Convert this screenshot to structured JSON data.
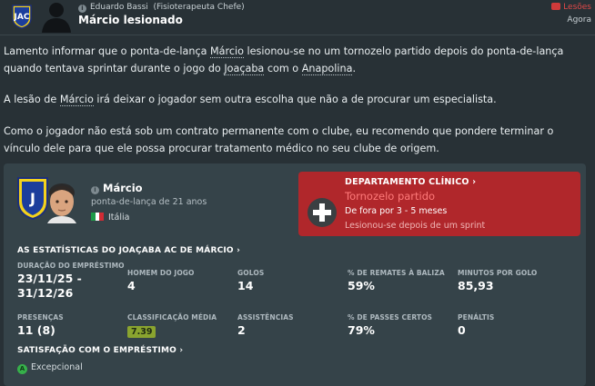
{
  "header": {
    "sender_name": "Eduardo Bassi",
    "sender_role": "(Fisioterapeuta Chefe)",
    "subject": "Márcio lesionado",
    "tag": "Lesões",
    "time": "Agora",
    "logo_letters": "JAC"
  },
  "body": {
    "p1": [
      {
        "t": "Lamento informar que o ponta-de-lança "
      },
      {
        "t": "Márcio",
        "u": true
      },
      {
        "t": " lesionou-se no um tornozelo partido depois do ponta-de-lança quando tentava sprintar durante o jogo do "
      },
      {
        "t": "Joaçaba",
        "u": true
      },
      {
        "t": " com o "
      },
      {
        "t": "Anapolina",
        "u": true
      },
      {
        "t": "."
      }
    ],
    "p2": [
      {
        "t": "A lesão de "
      },
      {
        "t": "Márcio",
        "u": true
      },
      {
        "t": " irá deixar o jogador sem outra escolha que não a de procurar um especialista."
      }
    ],
    "p3": [
      {
        "t": "Como o jogador não está sob um contrato permanente com o clube, eu recomendo que pondere terminar o vínculo dele para que ele possa procurar tratamento médico no seu clube de origem."
      }
    ]
  },
  "player": {
    "name": "Márcio",
    "position": "ponta-de-lança de 21 anos",
    "nationality": "Itália",
    "flag_colors": [
      "#1f9a48",
      "#ffffff",
      "#d12b34"
    ]
  },
  "medical": {
    "title": "DEPARTAMENTO CLÍNICO ›",
    "injury": "Tornozelo partido",
    "out": "De fora por 3 - 5 meses",
    "cause": "Lesionou-se depois de um sprint"
  },
  "stats_title": "AS ESTATÍSTICAS DO JOAÇABA AC DE MÁRCIO ›",
  "stats": {
    "loan_label": "DURAÇÃO DO EMPRÉSTIMO",
    "loan_value_1": "23/11/25 -",
    "loan_value_2": "31/12/26",
    "motm_label": "HOMEM DO JOGO",
    "motm_value": "4",
    "goals_label": "GOLOS",
    "goals_value": "14",
    "shots_label": "% DE REMATES À BALIZA",
    "shots_value": "59%",
    "mpg_label": "MINUTOS POR GOLO",
    "mpg_value": "85,93",
    "apps_label": "PRESENÇAS",
    "apps_value": "11 (8)",
    "rating_label": "CLASSIFICAÇÃO MÉDIA",
    "rating_value": "7.39",
    "assists_label": "ASSISTÊNCIAS",
    "assists_value": "2",
    "passes_label": "% DE PASSES CERTOS",
    "passes_value": "79%",
    "pens_label": "PENÁLTIS",
    "pens_value": "0"
  },
  "satisfaction": {
    "title": "SATISFAÇÃO COM O EMPRÉSTIMO ›",
    "icon_letter": "A",
    "value": "Excepcional"
  },
  "colors": {
    "background": "#283136",
    "card": "#354349",
    "medical_red": "#b0272b",
    "injury_text": "#ff7a7a",
    "rating_badge": "#8aa42f",
    "satisfaction_green": "#36b04a"
  }
}
